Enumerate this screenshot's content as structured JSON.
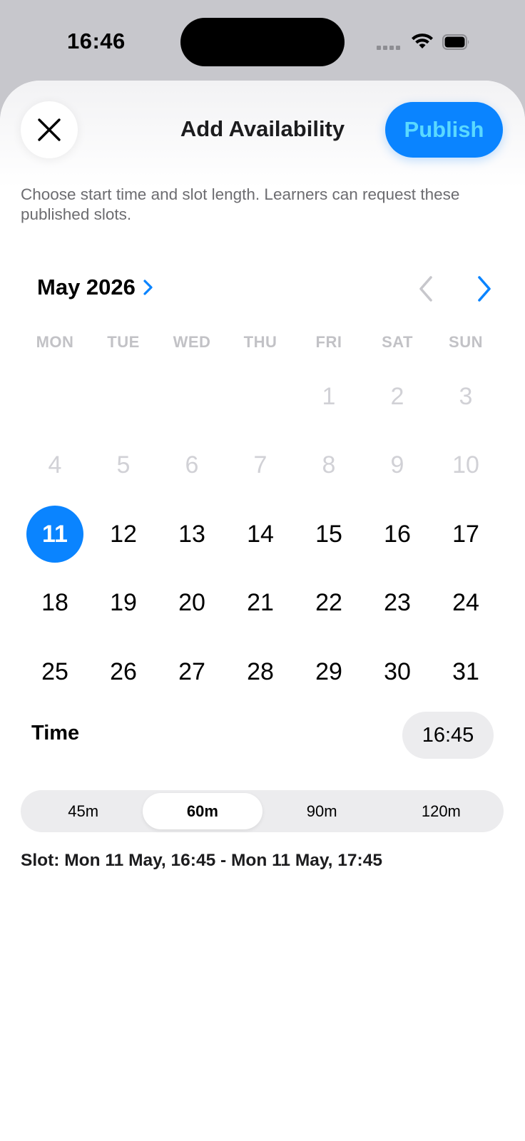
{
  "status_bar": {
    "time": "16:46"
  },
  "header": {
    "title": "Add Availability",
    "publish_label": "Publish",
    "close_icon": "close-icon"
  },
  "subtitle": "Choose start time and slot length. Learners can request these published slots.",
  "calendar": {
    "month_label": "May 2026",
    "weekdays": [
      "MON",
      "TUE",
      "WED",
      "THU",
      "FRI",
      "SAT",
      "SUN"
    ],
    "weeks": [
      [
        "",
        "",
        "",
        "",
        "1",
        "2",
        "3"
      ],
      [
        "4",
        "5",
        "6",
        "7",
        "8",
        "9",
        "10"
      ],
      [
        "11",
        "12",
        "13",
        "14",
        "15",
        "16",
        "17"
      ],
      [
        "18",
        "19",
        "20",
        "21",
        "22",
        "23",
        "24"
      ],
      [
        "25",
        "26",
        "27",
        "28",
        "29",
        "30",
        "31"
      ]
    ],
    "selected_day": "11",
    "first_enabled_day": 11
  },
  "time": {
    "label": "Time",
    "value": "16:45"
  },
  "duration": {
    "options": [
      "45m",
      "60m",
      "90m",
      "120m"
    ],
    "selected": "60m"
  },
  "slot_summary": "Slot: Mon 11 May, 16:45 - Mon 11 May, 17:45",
  "colors": {
    "accent": "#0a84ff",
    "publish_text": "#5ad9ff",
    "disabled_day": "#d1d1d6"
  }
}
